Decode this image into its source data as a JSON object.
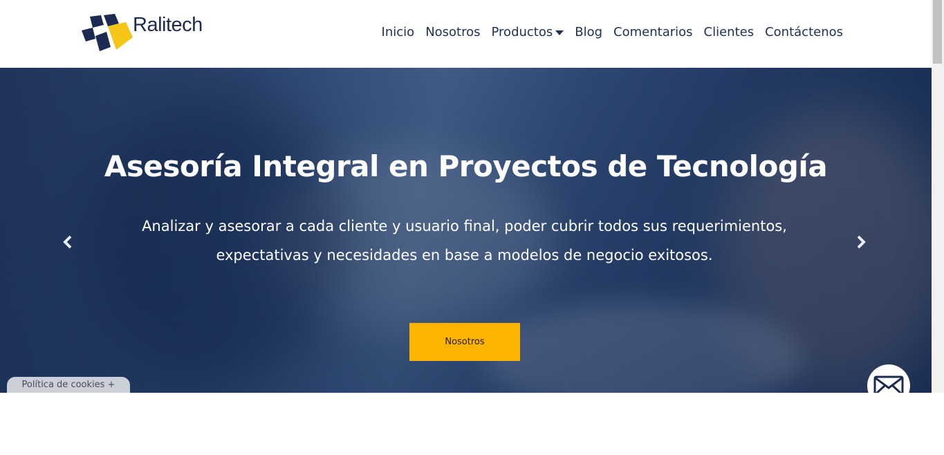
{
  "brand": {
    "name": "Ralitech",
    "colors": {
      "navy": "#1d2a52",
      "yellow": "#f5c518"
    }
  },
  "nav": {
    "items": [
      {
        "label": "Inicio"
      },
      {
        "label": "Nosotros"
      },
      {
        "label": "Productos",
        "dropdown": true
      },
      {
        "label": "Blog"
      },
      {
        "label": "Comentarios"
      },
      {
        "label": "Clientes"
      },
      {
        "label": "Contáctenos"
      }
    ]
  },
  "hero": {
    "title": "Asesoría Integral en Proyectos de Tecnología",
    "subtitle_line1": "Analizar y asesorar a cada cliente y usuario final, poder cubrir todos sus requerimientos,",
    "subtitle_line2": "expectativas y necesidades en base a modelos de negocio exitosos.",
    "button_label": "Nosotros",
    "prev_icon": "chevron-left-icon",
    "next_icon": "chevron-right-icon",
    "button_color": "#ffb400"
  },
  "cookies": {
    "label": "Política de cookies +"
  },
  "floating": {
    "mail_icon": "envelope-icon"
  }
}
